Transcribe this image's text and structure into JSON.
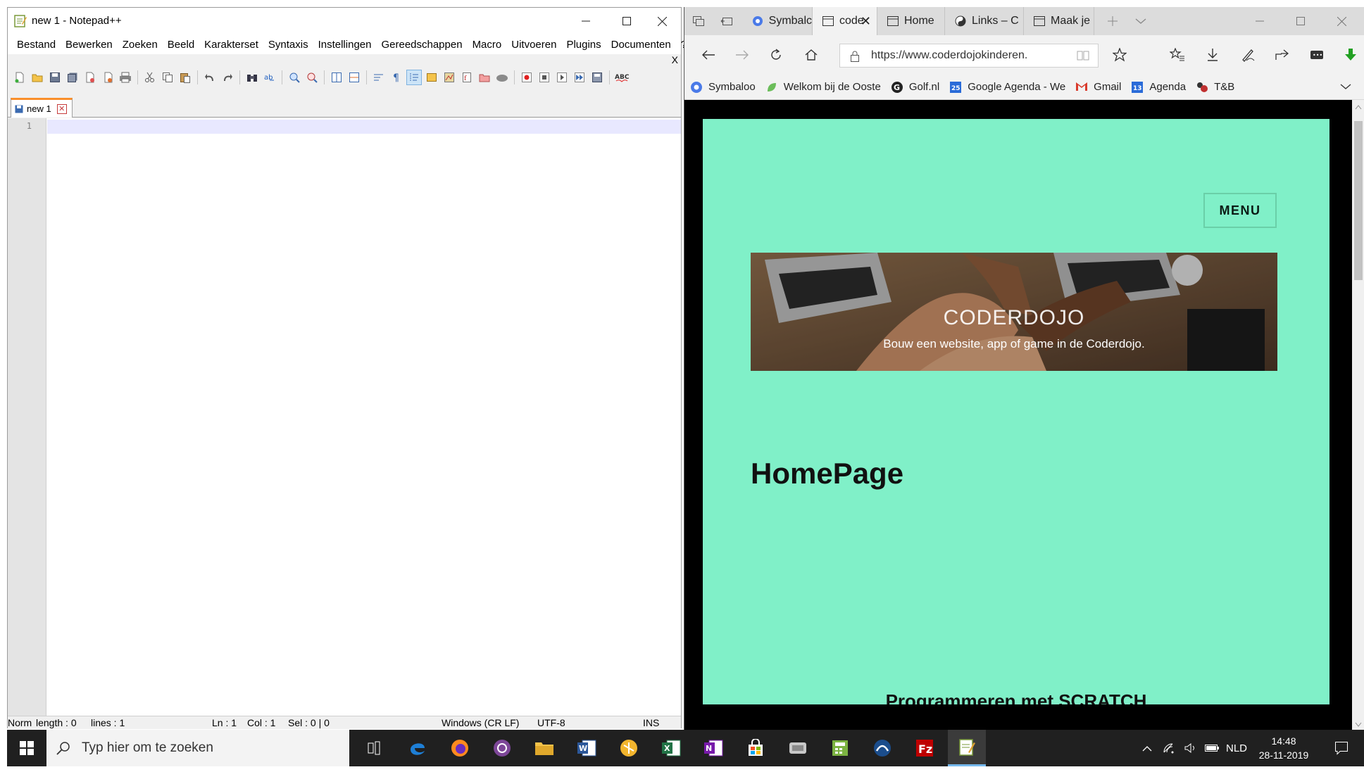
{
  "notepad": {
    "title": "new 1 - Notepad++",
    "menu": [
      "Bestand",
      "Bewerken",
      "Zoeken",
      "Beeld",
      "Karakterset",
      "Syntaxis",
      "Instellingen",
      "Gereedschappen",
      "Macro",
      "Uitvoeren",
      "Plugins",
      "Documenten",
      "?"
    ],
    "close_doc": "X",
    "tab_label": "new 1",
    "line_number": "1",
    "status": {
      "lang": "Norm",
      "length": "length : 0",
      "lines": "lines : 1",
      "ln": "Ln : 1",
      "col": "Col : 1",
      "sel": "Sel : 0 | 0",
      "eol": "Windows (CR LF)",
      "encoding": "UTF-8",
      "mode": "INS"
    }
  },
  "edge": {
    "tabs": [
      {
        "label": "Symbalc",
        "icon": "symbaloo-icon"
      },
      {
        "label": "code",
        "icon": "page-icon",
        "active": true
      },
      {
        "label": "Home",
        "icon": "page-icon"
      },
      {
        "label": "Links – C",
        "icon": "yin-yang-icon"
      },
      {
        "label": "Maak je",
        "icon": "page-icon"
      }
    ],
    "url": "https://www.coderdojokinderen.",
    "favorites": [
      "Symbaloo",
      "Welkom bij de Ooste",
      "Golf.nl",
      "Google Agenda - We",
      "Gmail",
      "Agenda",
      "T&B"
    ],
    "page": {
      "menu_label": "MENU",
      "hero_title": "CODERDOJO",
      "hero_subtitle": "Bouw een website, app of game in de Coderdojo.",
      "heading": "HomePage",
      "subheading": "Programmeren met SCRATCH"
    },
    "colors": {
      "page_bg": "#80f0c8"
    }
  },
  "taskbar": {
    "search_placeholder": "Typ hier om te zoeken",
    "language": "NLD",
    "time": "14:48",
    "date": "28-11-2019"
  }
}
